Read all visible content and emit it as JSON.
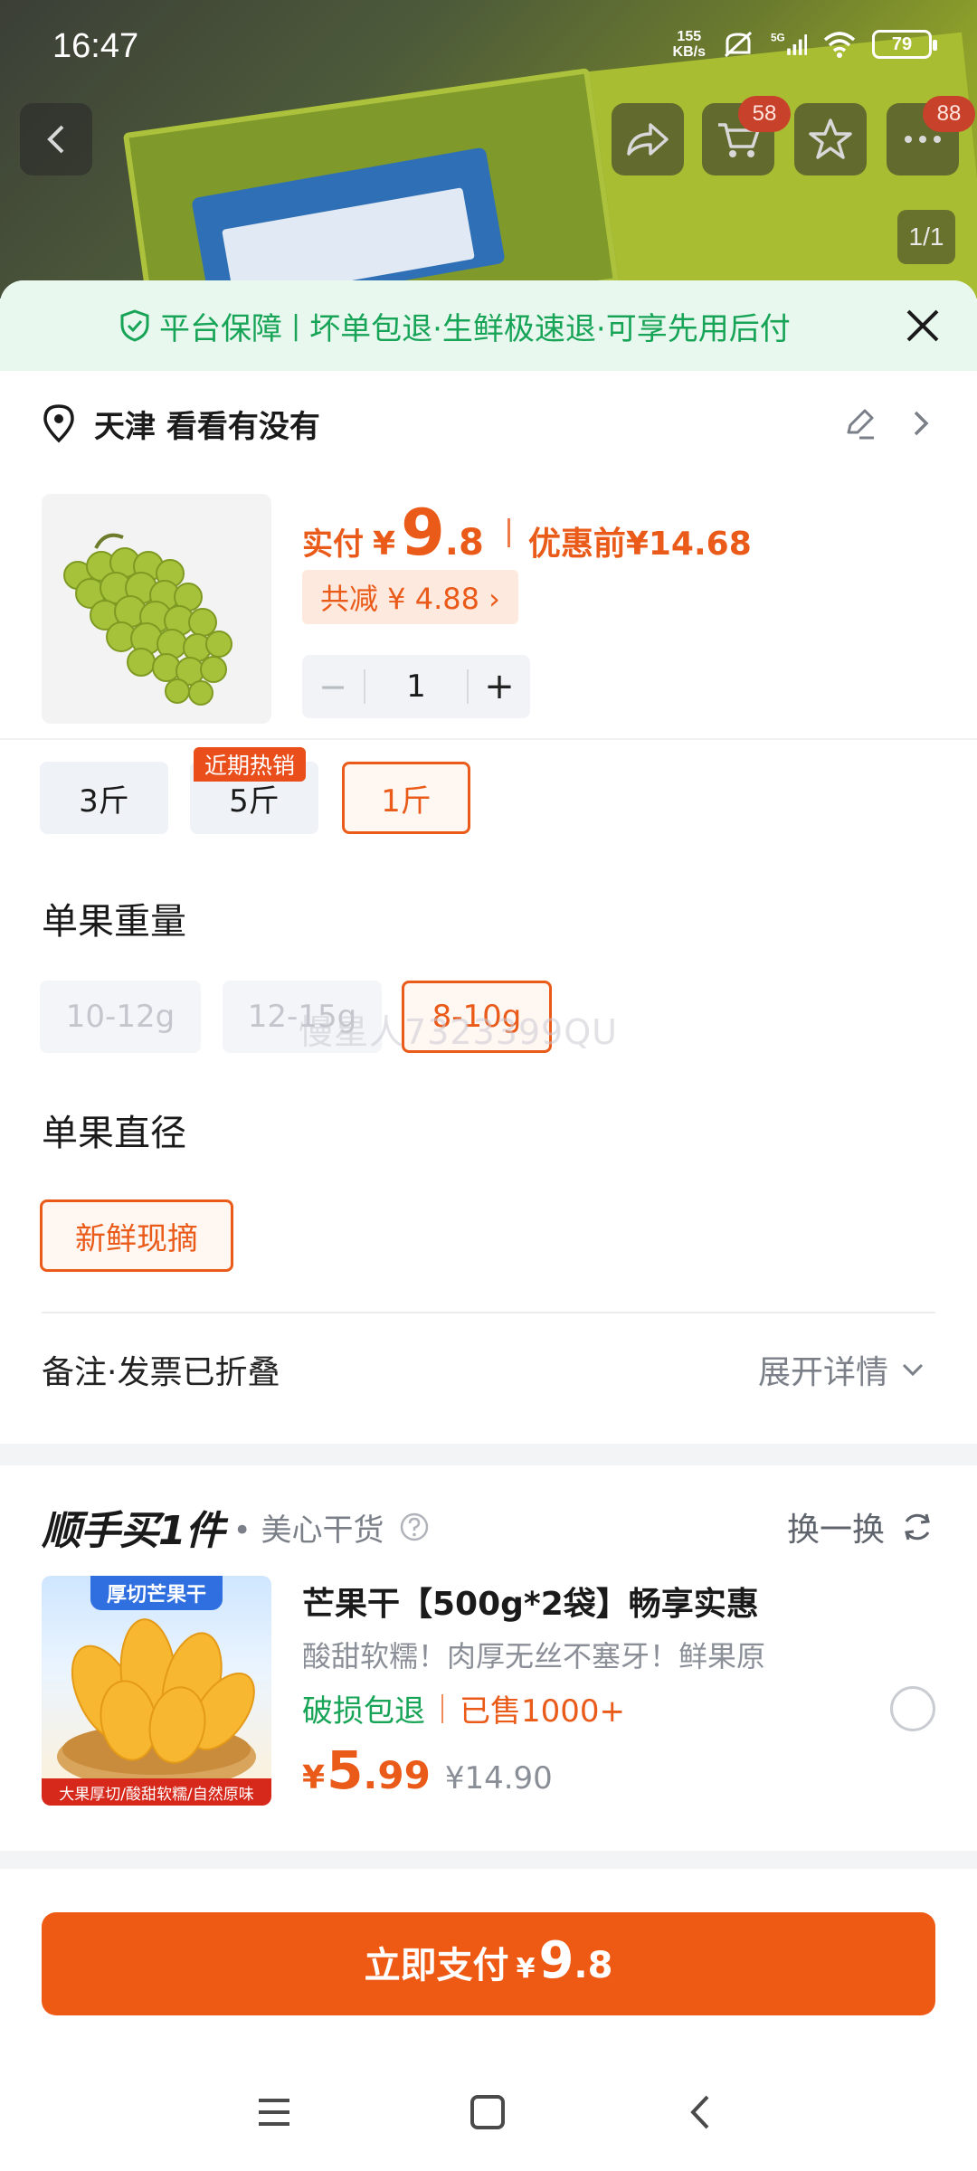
{
  "status_bar": {
    "time": "16:47",
    "net_speed_value": "155",
    "net_speed_unit": "KB/s",
    "network": "5G",
    "battery": "79"
  },
  "hero": {
    "cart_badge": "58",
    "more_badge": "88",
    "image_counter": "1/1"
  },
  "guarantee": {
    "label": "平台保障",
    "sep": "|",
    "text": "坏单包退·生鲜极速退·可享先用后付"
  },
  "address": {
    "text": "天津 看看有没有"
  },
  "product": {
    "pay_label": "实付",
    "currency": "¥",
    "price_int": "9",
    "price_dec": ".8",
    "original_label": "优惠前",
    "original_price": "¥14.68",
    "discount_text": "共减 ¥ 4.88 ›",
    "quantity": "1",
    "qty_minus": "−",
    "qty_plus": "+"
  },
  "spec_options": {
    "items": [
      {
        "label": "3斤",
        "state": "normal"
      },
      {
        "label": "5斤",
        "state": "normal",
        "tag": "近期热销"
      },
      {
        "label": "1斤",
        "state": "selected"
      }
    ]
  },
  "weight_section": {
    "title": "单果重量",
    "items": [
      {
        "label": "10-12g",
        "state": "disabled"
      },
      {
        "label": "12-15g",
        "state": "disabled"
      },
      {
        "label": "8-10g",
        "state": "selected"
      }
    ]
  },
  "watermark": "慢星人7323399QU",
  "diameter_section": {
    "title": "单果直径",
    "items": [
      {
        "label": "新鲜现摘",
        "state": "selected"
      }
    ]
  },
  "remarks": {
    "label": "备注·发票已折叠",
    "expand": "展开详情"
  },
  "addon": {
    "title": "顺手买1件",
    "subtitle": "• 美心干货",
    "swap_label": "换一换",
    "image_top_text": "厚切芒果干",
    "image_bottom_text": "大果厚切/酸甜软糯/自然原味",
    "name": "芒果干【500g*2袋】畅享实惠",
    "desc": "酸甜软糯！肉厚无丝不塞牙！鲜果原",
    "tag_return": "破损包退",
    "tag_sold": "已售1000+",
    "currency": "¥",
    "price_int": "5",
    "price_dec": ".99",
    "original_price": "¥14.90"
  },
  "pay_button": {
    "label": "立即支付",
    "currency": "¥",
    "price_int": "9",
    "price_dec": ".8"
  },
  "colors": {
    "accent": "#ee5a14",
    "green": "#17a457",
    "guarantee_bg": "#e8f8ee"
  }
}
